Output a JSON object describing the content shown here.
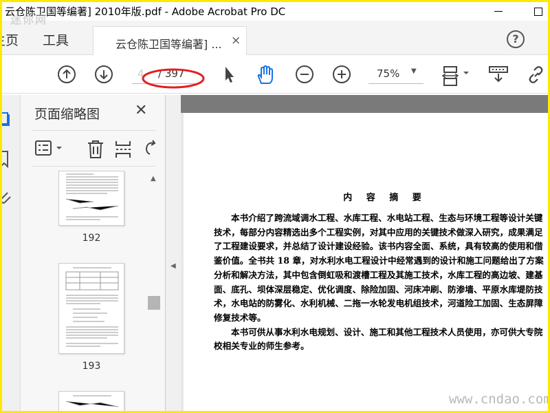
{
  "window": {
    "title": "云仓陈卫国等编著] 2010年版.pdf - Adobe Acrobat Pro DC",
    "minimize": "—",
    "maximize": "☐"
  },
  "tabs": {
    "home": "主页",
    "tools": "工具",
    "document": "云仓陈卫国等编著] ...",
    "close": "×",
    "help": "?"
  },
  "toolbar": {
    "current_page": "4",
    "total_pages": "/ 397",
    "zoom": "75%"
  },
  "thumbnails_panel": {
    "title": "页面缩略图",
    "close": "✕",
    "pages": [
      "192",
      "193"
    ]
  },
  "document": {
    "heading": "内 容 摘 要",
    "lines": [
      "本书介绍了跨流域调水工程、水库工程、水电站工程、生态与环境工程等设计关键",
      "技术，每部分内容精选出多个工程实例，对其中应用的关键技术做深入研究，成果满足",
      "了工程建设要求，并总结了设计建设经验。该书内容全面、系统，具有较高的使用和借",
      "鉴价值。全书共 18 章，对水利水电工程设计中经常遇到的设计和施工问题给出了方案",
      "分析和解决方法，其中包含倒虹吸和渡槽工程及其施工技术，水库工程的高边坡、建基",
      "面、底孔、坝体深层稳定、优化调度、除险加固、河床冲刷、防渗墙、平原水库堤防技",
      "术，水电站的防雾化、水利机械、二拖一水轮发电机组技术，河道险工加固、生态屏障",
      "修复技术等。",
      "本书可供从事水利水电规划、设计、施工和其他工程技术人员使用，亦可供大专院",
      "校相关专业的师生参考。"
    ]
  },
  "watermarks": {
    "top_left": "迷你网",
    "bottom_right": "www.cndao.com"
  },
  "colors": {
    "border": "#ffe800",
    "annotation_circle": "#e02020",
    "hand_tool": "#1473e6"
  }
}
